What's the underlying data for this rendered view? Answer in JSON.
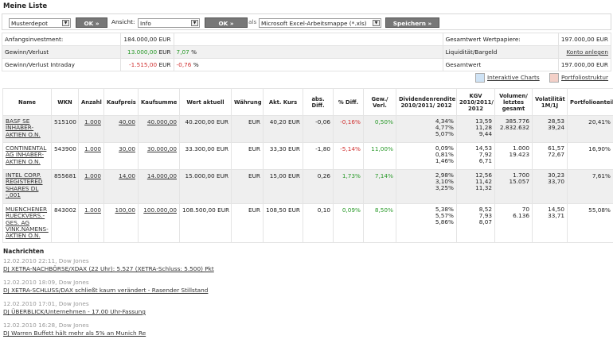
{
  "title": "Meine Liste",
  "toolbar": {
    "depot": "Musterdepot",
    "ok1": "OK »",
    "view_label": "Ansicht:",
    "view": "Info",
    "ok2": "OK »",
    "als": "als",
    "format": "Microsoft Excel-Arbeitsmappe (*.xls)",
    "save": "Speichern »"
  },
  "summary": {
    "rows": [
      {
        "label": "Anfangsinvestment:",
        "value": "184.000,00 EUR",
        "pct": "",
        "right_label": "Gesamtwert Wertpapiere:",
        "right_value": "197.000,00 EUR"
      },
      {
        "label": "Gewinn/Verlust",
        "value": "13.000,00",
        "unit": "EUR",
        "pct": "7,07",
        "pct_unit": "%",
        "right_label": "Liquidität/Bargeld",
        "right_value": "Konto anlegen"
      },
      {
        "label": "Gewinn/Verlust Intraday",
        "value": "-1.515,00",
        "unit": "EUR",
        "pct": "-0,76",
        "pct_unit": "%",
        "right_label": "Gesamtwert",
        "right_value": "197.000,00 EUR"
      }
    ]
  },
  "links": {
    "charts": "Interaktive Charts",
    "struktur": "Portfoliostruktur"
  },
  "columns": [
    "Name",
    "WKN",
    "Anzahl",
    "Kaufpreis",
    "Kaufsumme",
    "Wert aktuell",
    "Währung",
    "Akt. Kurs",
    "abs. Diff.",
    "% Diff.",
    "Gew./ Verl.",
    "Dividendenrendite 2010/2011/ 2012",
    "KGV 2010/2011/ 2012",
    "Volumen/ letztes gesamt",
    "Volatilität 1M/1J",
    "Portfolioanteil"
  ],
  "positions": [
    {
      "name": "BASF SE INHABER-AKTIEN O.N.",
      "wkn": "515100",
      "anzahl": "1.000",
      "kaufpreis": "40,00",
      "kaufsumme": "40.000,00",
      "wert": "40.200,00 EUR",
      "waehrung": "EUR",
      "kurs": "40,20 EUR",
      "abs": "-0,06",
      "pct": "-0,16%",
      "gew": "0,50%",
      "div": [
        "4,34%",
        "4,77%",
        "5,07%"
      ],
      "kgv": [
        "13,59",
        "11,28",
        "9,44"
      ],
      "vol": [
        "385.776",
        "2.832.632"
      ],
      "volat": [
        "28,53",
        "39,24"
      ],
      "anteil": "20,41%"
    },
    {
      "name": "CONTINENTAL AG INHABER-AKTIEN O.N.",
      "wkn": "543900",
      "anzahl": "1.000",
      "kaufpreis": "30,00",
      "kaufsumme": "30.000,00",
      "wert": "33.300,00 EUR",
      "waehrung": "EUR",
      "kurs": "33,30 EUR",
      "abs": "-1,80",
      "pct": "-5,14%",
      "gew": "11,00%",
      "div": [
        "0,09%",
        "0,81%",
        "1,46%"
      ],
      "kgv": [
        "14,53",
        "7,92",
        "6,71"
      ],
      "vol": [
        "1.000",
        "19.423"
      ],
      "volat": [
        "61,57",
        "72,67"
      ],
      "anteil": "16,90%"
    },
    {
      "name": "INTEL CORP. REGISTERED SHARES DL -,001",
      "wkn": "855681",
      "anzahl": "1.000",
      "kaufpreis": "14,00",
      "kaufsumme": "14.000,00",
      "wert": "15.000,00 EUR",
      "waehrung": "EUR",
      "kurs": "15,00 EUR",
      "abs": "0,26",
      "pct": "1,73%",
      "gew": "7,14%",
      "div": [
        "2,98%",
        "3,10%",
        "3,25%"
      ],
      "kgv": [
        "12,56",
        "11,42",
        "11,32"
      ],
      "vol": [
        "1.700",
        "15.057"
      ],
      "volat": [
        "30,23",
        "33,70"
      ],
      "anteil": "7,61%"
    },
    {
      "name": "MUENCHENER RUECKVERS.-GES. AG VINK.NAMENS-AKTIEN O.N.",
      "wkn": "843002",
      "anzahl": "1.000",
      "kaufpreis": "100,00",
      "kaufsumme": "100.000,00",
      "wert": "108.500,00 EUR",
      "waehrung": "EUR",
      "kurs": "108,50 EUR",
      "abs": "0,10",
      "pct": "0,09%",
      "gew": "8,50%",
      "div": [
        "5,38%",
        "5,57%",
        "5,86%"
      ],
      "kgv": [
        "8,52",
        "7,93",
        "8,07"
      ],
      "vol": [
        "70",
        "6.136"
      ],
      "volat": [
        "14,50",
        "33,71"
      ],
      "anteil": "55,08%"
    }
  ],
  "news": {
    "title": "Nachrichten",
    "items": [
      {
        "date": "12.02.2010 22:11, Dow Jones",
        "text": "DJ XETRA-NACHBÖRSE/XDAX (22 Uhr): 5.527 (XETRA-Schluss: 5.500) Pkt"
      },
      {
        "date": "12.02.2010 18:09, Dow Jones",
        "text": "DJ XETRA-SCHLUSS/DAX schließt kaum verändert - Rasender Stillstand"
      },
      {
        "date": "12.02.2010 17:01, Dow Jones",
        "text": "DJ ÜBERBLICK/Unternehmen - 17.00 Uhr-Fassung"
      },
      {
        "date": "12.02.2010 16:28, Dow Jones",
        "text": "DJ Warren Buffett hält mehr als 5% an Munich Re"
      }
    ]
  },
  "colors": {
    "positive": "#2a9a2a",
    "negative": "#d03030",
    "button": "#777777"
  }
}
